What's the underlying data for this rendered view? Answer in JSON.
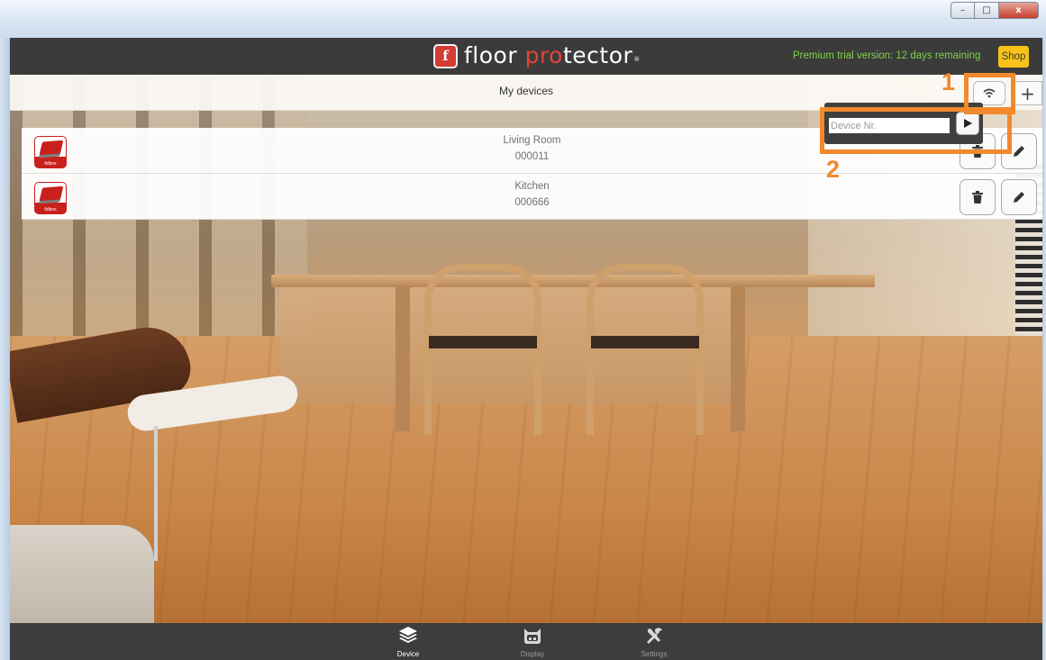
{
  "app": {
    "brand_prefix": "floor ",
    "brand_accent": "pro",
    "brand_suffix": "tector",
    "brand_tm": "®",
    "logo_glyph": "f",
    "trial_text": "Premium trial version: 12 days remaining",
    "shop_label": "Shop"
  },
  "window": {
    "min_glyph": "–",
    "max_glyph": "□",
    "close_glyph": "x"
  },
  "subheader": {
    "title": "My devices",
    "add_glyph": "+"
  },
  "devices": [
    {
      "name": "Living Room",
      "id": "000011",
      "icon_brand": "fidbox"
    },
    {
      "name": "Kitchen",
      "id": "000666",
      "icon_brand": "fidbox"
    }
  ],
  "popup": {
    "placeholder": "Device Nr.",
    "value": ""
  },
  "callouts": [
    {
      "number": "1"
    },
    {
      "number": "2"
    }
  ],
  "nav": {
    "items": [
      {
        "label": "Device",
        "icon": "layers-icon",
        "active": true
      },
      {
        "label": "Display",
        "icon": "display-icon",
        "active": false
      },
      {
        "label": "Settings",
        "icon": "tools-icon",
        "active": false
      }
    ]
  },
  "colors": {
    "header_bg": "#3b3b3b",
    "brand_accent": "#e3433b",
    "trial_text": "#7ed24a",
    "shop_bg": "#f7c31a",
    "callout": "#f08a2c"
  }
}
